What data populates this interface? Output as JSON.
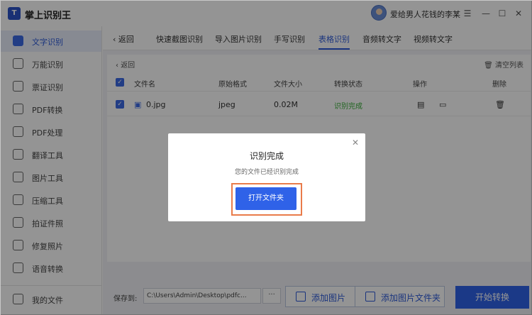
{
  "app": {
    "title": "掌上识别王",
    "logo_text": "T"
  },
  "user": {
    "name": "爱给男人花钱的李某"
  },
  "window_controls": {
    "menu": "☰",
    "minimize": "—",
    "maximize": "☐",
    "close": "✕"
  },
  "sidebar": {
    "items": [
      {
        "label": "文字识别",
        "icon": "text-recognition-icon",
        "active": true
      },
      {
        "label": "万能识别",
        "icon": "universal-recognition-icon"
      },
      {
        "label": "票证识别",
        "icon": "ticket-recognition-icon"
      },
      {
        "label": "PDF转换",
        "icon": "pdf-convert-icon"
      },
      {
        "label": "PDF处理",
        "icon": "pdf-process-icon"
      },
      {
        "label": "翻译工具",
        "icon": "translate-icon"
      },
      {
        "label": "图片工具",
        "icon": "image-tool-icon"
      },
      {
        "label": "压缩工具",
        "icon": "compress-icon"
      },
      {
        "label": "拍证件照",
        "icon": "id-photo-icon"
      },
      {
        "label": "修复照片",
        "icon": "repair-photo-icon"
      },
      {
        "label": "语音转换",
        "icon": "voice-convert-icon"
      }
    ],
    "my_files": "我的文件"
  },
  "tabs": {
    "back": "返回",
    "items": [
      "快速截图识别",
      "导入图片识别",
      "手写识别",
      "表格识别",
      "音频转文字",
      "视频转文字"
    ],
    "active": "表格识别"
  },
  "panel": {
    "back": "返回",
    "clear_list": "清空列表",
    "headers": [
      "文件名",
      "原始格式",
      "文件大小",
      "转换状态",
      "操作",
      "删除"
    ],
    "rows": [
      {
        "name": "0.jpg",
        "format": "jpeg",
        "size": "0.02M",
        "status": "识别完成"
      }
    ]
  },
  "bottom": {
    "save_to": "保存到:",
    "path": "C:\\Users\\Admin\\Desktop\\pdfc...",
    "more": "···",
    "add_image": "添加图片",
    "add_folder": "添加图片文件夹",
    "start": "开始转换"
  },
  "modal": {
    "title": "识别完成",
    "message": "您的文件已经识别完成",
    "button": "打开文件夹",
    "close": "✕"
  }
}
